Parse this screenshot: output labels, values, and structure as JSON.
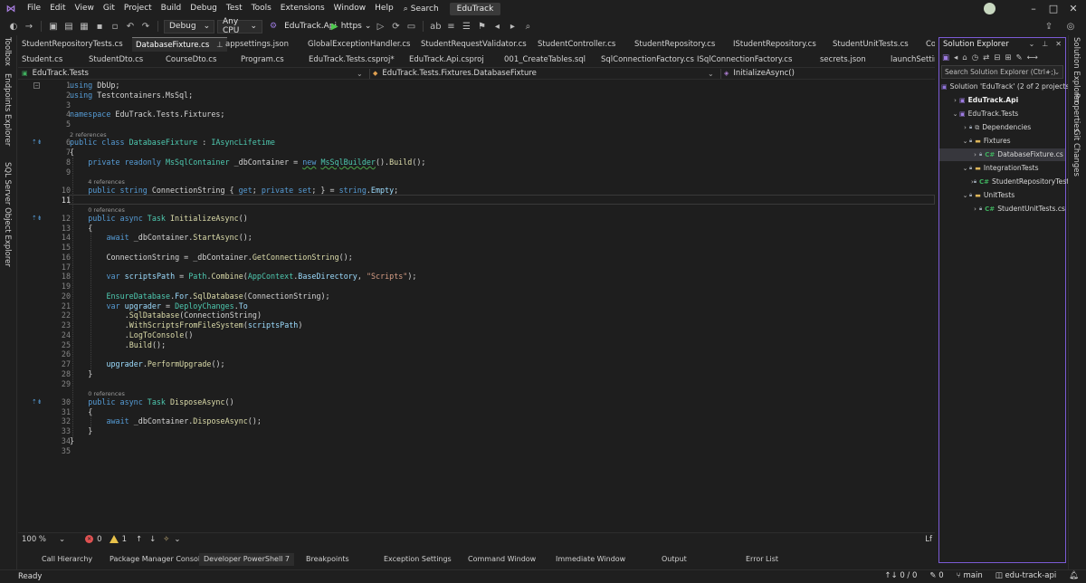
{
  "menu": [
    "File",
    "Edit",
    "View",
    "Git",
    "Project",
    "Build",
    "Debug",
    "Test",
    "Tools",
    "Extensions",
    "Window",
    "Help"
  ],
  "search_label": "Search",
  "solution_name": "EduTrack",
  "toolbar": {
    "config": "Debug",
    "platform": "Any CPU",
    "startup_project": "EduTrack.Api",
    "run_profile": "https"
  },
  "left_rail": [
    "Toolbox",
    "Endpoints Explorer",
    "SQL Server Object Explorer"
  ],
  "right_rail": [
    "Solution Explorer",
    "Properties",
    "Git Changes"
  ],
  "tabs_row1": [
    {
      "label": "StudentRepositoryTests.cs",
      "active": false
    },
    {
      "label": "DatabaseFixture.cs",
      "active": true
    },
    {
      "label": "appsettings.json",
      "active": false
    },
    {
      "label": "GlobalExceptionHandler.cs",
      "active": false
    },
    {
      "label": "StudentRequestValidator.cs",
      "active": false
    },
    {
      "label": "StudentController.cs",
      "active": false
    },
    {
      "label": "StudentRepository.cs",
      "active": false
    },
    {
      "label": "IStudentRepository.cs",
      "active": false
    },
    {
      "label": "StudentUnitTests.cs",
      "active": false
    },
    {
      "label": "Co",
      "active": false
    }
  ],
  "tabs_row2": [
    "Student.cs",
    "StudentDto.cs",
    "CourseDto.cs",
    "Program.cs",
    "EduTrack.Tests.csproj*",
    "EduTrack.Api.csproj",
    "001_CreateTables.sql",
    "SqlConnectionFactory.cs",
    "ISqlConnectionFactory.cs",
    "secrets.json",
    "launchSettings"
  ],
  "nav": {
    "project": "EduTrack.Tests",
    "type": "EduTrack.Tests.Fixtures.DatabaseFixture",
    "member": "InitializeAsync()"
  },
  "editor": {
    "current_line": 11,
    "codelens": [
      {
        "before_line": 6,
        "text": "2 references"
      },
      {
        "before_line": 10,
        "text": "4 references"
      },
      {
        "before_line": 12,
        "text": "0 references"
      },
      {
        "before_line": 30,
        "text": "0 references"
      }
    ],
    "lines": [
      {
        "n": 1,
        "indent": 0,
        "tokens": [
          [
            "kw",
            "using"
          ],
          [
            "p",
            " DbUp;"
          ]
        ]
      },
      {
        "n": 2,
        "indent": 0,
        "tokens": [
          [
            "kw",
            "using"
          ],
          [
            "p",
            " Testcontainers.MsSql;"
          ]
        ]
      },
      {
        "n": 3,
        "indent": 0,
        "tokens": []
      },
      {
        "n": 4,
        "indent": 0,
        "tokens": [
          [
            "kw",
            "namespace"
          ],
          [
            "p",
            " EduTrack.Tests.Fixtures;"
          ]
        ]
      },
      {
        "n": 5,
        "indent": 0,
        "tokens": []
      },
      {
        "n": 6,
        "indent": 0,
        "tokens": [
          [
            "kw",
            "public class"
          ],
          [
            "p",
            " "
          ],
          [
            "ty",
            "DatabaseFixture"
          ],
          [
            "p",
            " : "
          ],
          [
            "ty",
            "IAsyncLifetime"
          ]
        ]
      },
      {
        "n": 7,
        "indent": 0,
        "tokens": [
          [
            "p",
            "{"
          ]
        ]
      },
      {
        "n": 8,
        "indent": 1,
        "tokens": [
          [
            "kw",
            "private readonly"
          ],
          [
            "p",
            " "
          ],
          [
            "ty",
            "MsSqlContainer"
          ],
          [
            "p",
            " _dbContainer = "
          ],
          [
            "kwu",
            "new"
          ],
          [
            "p",
            " "
          ],
          [
            "tyu",
            "MsSqlBuilder"
          ],
          [
            "p",
            "()."
          ],
          [
            "fn",
            "Build"
          ],
          [
            "p",
            "();"
          ]
        ]
      },
      {
        "n": 9,
        "indent": 0,
        "tokens": []
      },
      {
        "n": 10,
        "indent": 1,
        "tokens": [
          [
            "kw",
            "public string"
          ],
          [
            "p",
            " ConnectionString { "
          ],
          [
            "kw",
            "get"
          ],
          [
            "p",
            "; "
          ],
          [
            "kw",
            "private set"
          ],
          [
            "p",
            "; } = "
          ],
          [
            "kw",
            "string"
          ],
          [
            "p",
            "."
          ],
          [
            "id",
            "Empty"
          ],
          [
            "p",
            ";"
          ]
        ]
      },
      {
        "n": 11,
        "indent": 0,
        "tokens": []
      },
      {
        "n": 12,
        "indent": 1,
        "tokens": [
          [
            "kw",
            "public async"
          ],
          [
            "p",
            " "
          ],
          [
            "ty",
            "Task"
          ],
          [
            "p",
            " "
          ],
          [
            "fn",
            "InitializeAsync"
          ],
          [
            "p",
            "()"
          ]
        ]
      },
      {
        "n": 13,
        "indent": 1,
        "tokens": [
          [
            "p",
            "{"
          ]
        ]
      },
      {
        "n": 14,
        "indent": 2,
        "tokens": [
          [
            "kw",
            "await"
          ],
          [
            "p",
            " _dbContainer."
          ],
          [
            "fn",
            "StartAsync"
          ],
          [
            "p",
            "();"
          ]
        ]
      },
      {
        "n": 15,
        "indent": 0,
        "tokens": []
      },
      {
        "n": 16,
        "indent": 2,
        "tokens": [
          [
            "p",
            "ConnectionString = _dbContainer."
          ],
          [
            "fn",
            "GetConnectionString"
          ],
          [
            "p",
            "();"
          ]
        ]
      },
      {
        "n": 17,
        "indent": 0,
        "tokens": []
      },
      {
        "n": 18,
        "indent": 2,
        "tokens": [
          [
            "kw",
            "var"
          ],
          [
            "p",
            " "
          ],
          [
            "id",
            "scriptsPath"
          ],
          [
            "p",
            " = "
          ],
          [
            "ty",
            "Path"
          ],
          [
            "p",
            "."
          ],
          [
            "fn",
            "Combine"
          ],
          [
            "p",
            "("
          ],
          [
            "ty",
            "AppContext"
          ],
          [
            "p",
            "."
          ],
          [
            "id",
            "BaseDirectory"
          ],
          [
            "p",
            ", "
          ],
          [
            "st",
            "\"Scripts\""
          ],
          [
            "p",
            ");"
          ]
        ]
      },
      {
        "n": 19,
        "indent": 0,
        "tokens": []
      },
      {
        "n": 20,
        "indent": 2,
        "tokens": [
          [
            "ty",
            "EnsureDatabase"
          ],
          [
            "p",
            "."
          ],
          [
            "id",
            "For"
          ],
          [
            "p",
            "."
          ],
          [
            "fn",
            "SqlDatabase"
          ],
          [
            "p",
            "(ConnectionString);"
          ]
        ]
      },
      {
        "n": 21,
        "indent": 2,
        "tokens": [
          [
            "kw",
            "var"
          ],
          [
            "p",
            " "
          ],
          [
            "id",
            "upgrader"
          ],
          [
            "p",
            " = "
          ],
          [
            "ty",
            "DeployChanges"
          ],
          [
            "p",
            "."
          ],
          [
            "id",
            "To"
          ]
        ]
      },
      {
        "n": 22,
        "indent": 3,
        "tokens": [
          [
            "p",
            "."
          ],
          [
            "fn",
            "SqlDatabase"
          ],
          [
            "p",
            "(ConnectionString)"
          ]
        ]
      },
      {
        "n": 23,
        "indent": 3,
        "tokens": [
          [
            "p",
            "."
          ],
          [
            "fn",
            "WithScriptsFromFileSystem"
          ],
          [
            "p",
            "("
          ],
          [
            "id",
            "scriptsPath"
          ],
          [
            "p",
            ")"
          ]
        ]
      },
      {
        "n": 24,
        "indent": 3,
        "tokens": [
          [
            "p",
            "."
          ],
          [
            "fn",
            "LogToConsole"
          ],
          [
            "p",
            "()"
          ]
        ]
      },
      {
        "n": 25,
        "indent": 3,
        "tokens": [
          [
            "p",
            "."
          ],
          [
            "fn",
            "Build"
          ],
          [
            "p",
            "();"
          ]
        ]
      },
      {
        "n": 26,
        "indent": 0,
        "tokens": []
      },
      {
        "n": 27,
        "indent": 2,
        "tokens": [
          [
            "id",
            "upgrader"
          ],
          [
            "p",
            "."
          ],
          [
            "fn",
            "PerformUpgrade"
          ],
          [
            "p",
            "();"
          ]
        ]
      },
      {
        "n": 28,
        "indent": 1,
        "tokens": [
          [
            "p",
            "}"
          ]
        ]
      },
      {
        "n": 29,
        "indent": 0,
        "tokens": []
      },
      {
        "n": 30,
        "indent": 1,
        "tokens": [
          [
            "kw",
            "public async"
          ],
          [
            "p",
            " "
          ],
          [
            "ty",
            "Task"
          ],
          [
            "p",
            " "
          ],
          [
            "fn",
            "DisposeAsync"
          ],
          [
            "p",
            "()"
          ]
        ]
      },
      {
        "n": 31,
        "indent": 1,
        "tokens": [
          [
            "p",
            "{"
          ]
        ]
      },
      {
        "n": 32,
        "indent": 2,
        "tokens": [
          [
            "kw",
            "await"
          ],
          [
            "p",
            " _dbContainer."
          ],
          [
            "fn",
            "DisposeAsync"
          ],
          [
            "p",
            "();"
          ]
        ]
      },
      {
        "n": 33,
        "indent": 1,
        "tokens": [
          [
            "p",
            "}"
          ]
        ]
      },
      {
        "n": 34,
        "indent": 0,
        "tokens": [
          [
            "p",
            "}"
          ]
        ]
      },
      {
        "n": 35,
        "indent": 0,
        "tokens": []
      }
    ]
  },
  "status_strip": {
    "zoom": "100 %",
    "errors": "0",
    "warnings": "1",
    "line_ending": "Lf"
  },
  "solution_explorer": {
    "title": "Solution Explorer",
    "search_placeholder": "Search Solution Explorer (Ctrl+;)",
    "nodes": [
      {
        "label": "Solution 'EduTrack' (2 of 2 projects)",
        "level": 0,
        "icon": "sol",
        "chev": "",
        "bold": false,
        "selected": false
      },
      {
        "label": "EduTrack.Api",
        "level": 1,
        "icon": "csproj",
        "chev": "›",
        "bold": true,
        "selected": false
      },
      {
        "label": "EduTrack.Tests",
        "level": 1,
        "icon": "csproj",
        "chev": "⌄",
        "bold": false,
        "selected": false
      },
      {
        "label": "Dependencies",
        "level": 2,
        "icon": "dep",
        "chev": "›",
        "bold": false,
        "selected": false
      },
      {
        "label": "Fixtures",
        "level": 2,
        "icon": "folder",
        "chev": "⌄",
        "bold": false,
        "selected": false
      },
      {
        "label": "DatabaseFixture.cs",
        "level": 3,
        "icon": "cs",
        "chev": "›",
        "bold": false,
        "selected": true
      },
      {
        "label": "IntegrationTests",
        "level": 2,
        "icon": "folder",
        "chev": "⌄",
        "bold": false,
        "selected": false
      },
      {
        "label": "StudentRepositoryTests.cs",
        "level": 3,
        "icon": "cs",
        "chev": "›",
        "bold": false,
        "selected": false
      },
      {
        "label": "UnitTests",
        "level": 2,
        "icon": "folder",
        "chev": "⌄",
        "bold": false,
        "selected": false
      },
      {
        "label": "StudentUnitTests.cs",
        "level": 3,
        "icon": "cs",
        "chev": "›",
        "bold": false,
        "selected": false
      }
    ]
  },
  "tool_tabs": [
    "Call Hierarchy",
    "Package Manager Console",
    "Developer PowerShell 7",
    "Breakpoints",
    "Exception Settings",
    "Command Window",
    "Immediate Window",
    "Output",
    "Error List"
  ],
  "statusbar": {
    "ready": "Ready",
    "changes": "0 / 0",
    "pencil_count": "0",
    "branch": "main",
    "repo": "edu-track-api"
  }
}
